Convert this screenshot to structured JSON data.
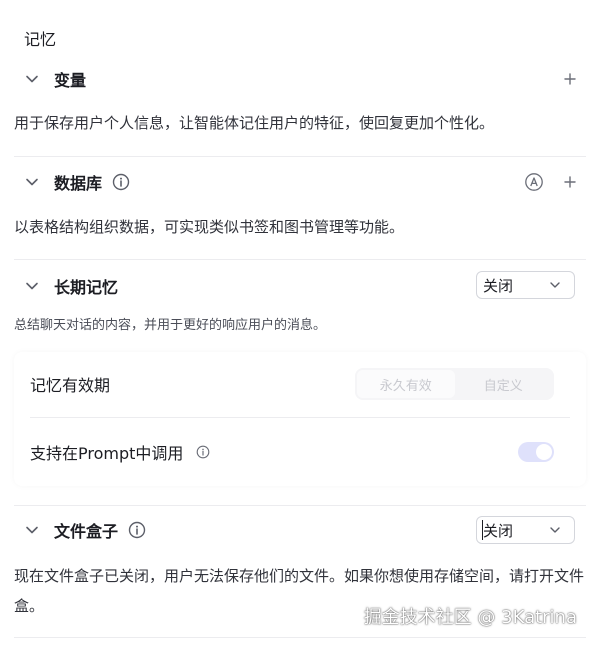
{
  "header": {
    "title": "记忆"
  },
  "variables": {
    "title": "变量",
    "description": "用于保存用户个人信息，让智能体记住用户的特征，使回复更加个性化。"
  },
  "database": {
    "title": "数据库",
    "description": "以表格结构组织数据，可实现类似书签和图书管理等功能。"
  },
  "long_term_memory": {
    "title": "长期记忆",
    "select_value": "关闭",
    "description": "总结聊天对话的内容，并用于更好的响应用户的消息。",
    "validity": {
      "label": "记忆有效期",
      "options": [
        "永久有效",
        "自定义"
      ],
      "selected": "永久有效"
    },
    "prompt_support": {
      "label": "支持在Prompt中调用",
      "enabled": true
    }
  },
  "file_box": {
    "title": "文件盒子",
    "select_value": "关闭",
    "description": "现在文件盒子已关闭，用户无法保存他们的文件。如果你想使用存储空间，请打开文件盒。"
  },
  "watermark": "掘金技术社区 @ 3Katrina",
  "colors": {
    "text_primary": "#1c1d23",
    "divider": "#ececef",
    "toggle_track": "#dfe1fb",
    "icon_gray": "#6b6e78"
  }
}
